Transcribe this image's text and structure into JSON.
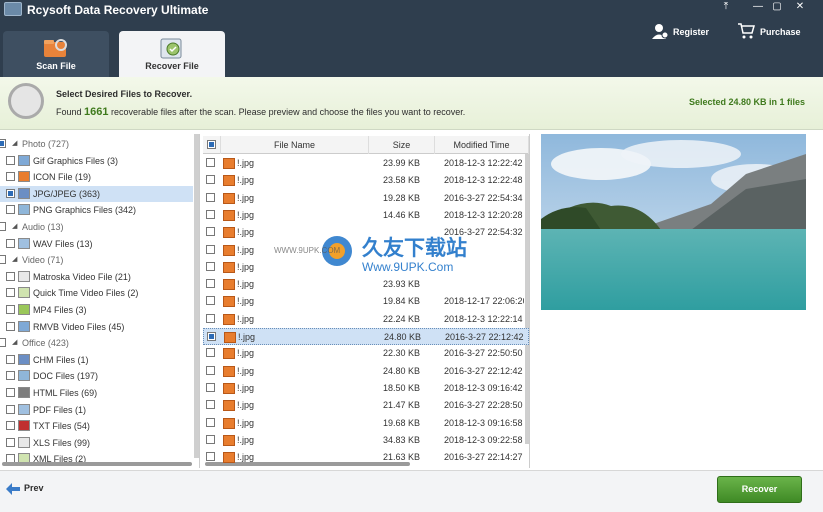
{
  "app": {
    "title": "Rcysoft Data Recovery Ultimate"
  },
  "tabs": [
    {
      "label": "Scan File"
    },
    {
      "label": "Recover File"
    }
  ],
  "header_links": {
    "register": "Register",
    "purchase": "Purchase"
  },
  "banner": {
    "title": "Select Desired Files to Recover.",
    "msg_prefix": "Found",
    "found_count": "1661",
    "msg_suffix": "recoverable files after the scan. Please preview and choose the files you want to recover.",
    "selected_info": "Selected 24.80 KB in 1 files"
  },
  "tree": {
    "items": [
      {
        "label": "Photo (727)",
        "kind": "category"
      },
      {
        "label": "Gif Graphics Files (3)",
        "kind": "file"
      },
      {
        "label": "ICON File (19)",
        "kind": "file"
      },
      {
        "label": "JPG/JPEG (363)",
        "kind": "file"
      },
      {
        "label": "PNG Graphics Files (342)",
        "kind": "file"
      },
      {
        "label": "Audio (13)",
        "kind": "category"
      },
      {
        "label": "WAV Files (13)",
        "kind": "file"
      },
      {
        "label": "Video (71)",
        "kind": "category"
      },
      {
        "label": "Matroska Video File (21)",
        "kind": "file"
      },
      {
        "label": "Quick Time Video Files (2)",
        "kind": "file"
      },
      {
        "label": "MP4 Files (3)",
        "kind": "file"
      },
      {
        "label": "RMVB Video Files (45)",
        "kind": "file"
      },
      {
        "label": "Office (423)",
        "kind": "category"
      },
      {
        "label": "CHM Files (1)",
        "kind": "file"
      },
      {
        "label": "DOC Files (197)",
        "kind": "file"
      },
      {
        "label": "HTML Files (69)",
        "kind": "file"
      },
      {
        "label": "PDF Files (1)",
        "kind": "file"
      },
      {
        "label": "TXT Files (54)",
        "kind": "file"
      },
      {
        "label": "XLS Files (99)",
        "kind": "file"
      },
      {
        "label": "XML Files (2)",
        "kind": "file"
      }
    ],
    "selected_index": 3
  },
  "list": {
    "columns": {
      "name": "File Name",
      "size": "Size",
      "modified": "Modified Time"
    },
    "rows": [
      {
        "name": "!.jpg",
        "size": "23.99 KB",
        "modified": "2018-12-3 12:22:42"
      },
      {
        "name": "!.jpg",
        "size": "23.58 KB",
        "modified": "2018-12-3 12:22:48"
      },
      {
        "name": "!.jpg",
        "size": "19.28 KB",
        "modified": "2016-3-27 22:54:34"
      },
      {
        "name": "!.jpg",
        "size": "14.46 KB",
        "modified": "2018-12-3 12:20:28"
      },
      {
        "name": "!.jpg",
        "size": "",
        "modified": "2016-3-27 22:54:32"
      },
      {
        "name": "!.jpg",
        "size": "",
        "modified": ""
      },
      {
        "name": "!.jpg",
        "size": "",
        "modified": ""
      },
      {
        "name": "!.jpg",
        "size": "23.93 KB",
        "modified": ""
      },
      {
        "name": "!.jpg",
        "size": "19.84 KB",
        "modified": "2018-12-17 22:06:20"
      },
      {
        "name": "!.jpg",
        "size": "22.24 KB",
        "modified": "2018-12-3 12:22:14"
      },
      {
        "name": "!.jpg",
        "size": "24.80 KB",
        "modified": "2016-3-27 22:12:42"
      },
      {
        "name": "!.jpg",
        "size": "22.30 KB",
        "modified": "2016-3-27 22:50:50"
      },
      {
        "name": "!.jpg",
        "size": "24.80 KB",
        "modified": "2016-3-27 22:12:42"
      },
      {
        "name": "!.jpg",
        "size": "18.50 KB",
        "modified": "2018-12-3 09:16:42"
      },
      {
        "name": "!.jpg",
        "size": "21.47 KB",
        "modified": "2016-3-27 22:28:50"
      },
      {
        "name": "!.jpg",
        "size": "19.68 KB",
        "modified": "2018-12-3 09:16:58"
      },
      {
        "name": "!.jpg",
        "size": "34.83 KB",
        "modified": "2018-12-3 09:22:58"
      },
      {
        "name": "!.jpg",
        "size": "21.63 KB",
        "modified": "2016-3-27 22:14:27"
      }
    ],
    "selected_index": 10
  },
  "watermark": {
    "cn": "久友下载站",
    "url": "Www.9UPK.Com",
    "small": "WWW.9UPK.COM"
  },
  "footer": {
    "prev": "Prev",
    "recover": "Recover"
  },
  "colors": {
    "header_bg": "#2f3e4e",
    "accent_green": "#3f7a1d",
    "selection": "#cfe1f5",
    "recover_btn": "#4c9a30"
  }
}
